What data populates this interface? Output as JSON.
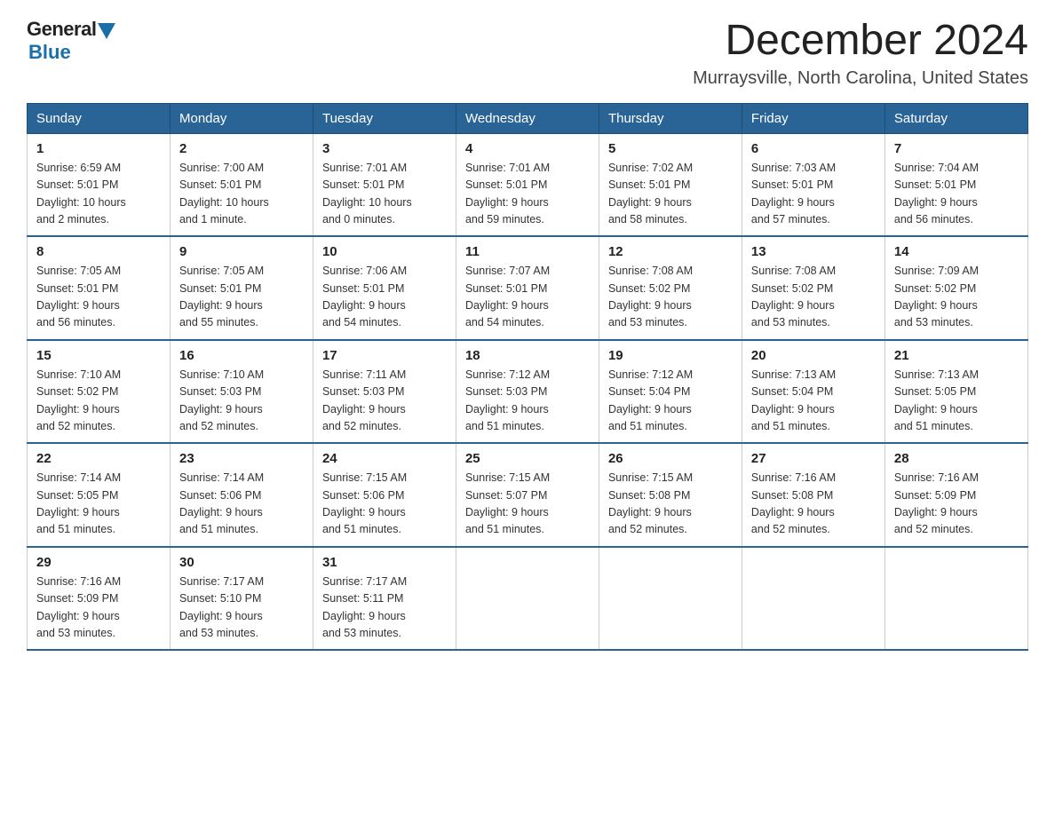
{
  "logo": {
    "general": "General",
    "blue": "Blue",
    "tagline": ""
  },
  "title": "December 2024",
  "subtitle": "Murraysville, North Carolina, United States",
  "weekdays": [
    "Sunday",
    "Monday",
    "Tuesday",
    "Wednesday",
    "Thursday",
    "Friday",
    "Saturday"
  ],
  "weeks": [
    [
      {
        "day": "1",
        "info": "Sunrise: 6:59 AM\nSunset: 5:01 PM\nDaylight: 10 hours\nand 2 minutes."
      },
      {
        "day": "2",
        "info": "Sunrise: 7:00 AM\nSunset: 5:01 PM\nDaylight: 10 hours\nand 1 minute."
      },
      {
        "day": "3",
        "info": "Sunrise: 7:01 AM\nSunset: 5:01 PM\nDaylight: 10 hours\nand 0 minutes."
      },
      {
        "day": "4",
        "info": "Sunrise: 7:01 AM\nSunset: 5:01 PM\nDaylight: 9 hours\nand 59 minutes."
      },
      {
        "day": "5",
        "info": "Sunrise: 7:02 AM\nSunset: 5:01 PM\nDaylight: 9 hours\nand 58 minutes."
      },
      {
        "day": "6",
        "info": "Sunrise: 7:03 AM\nSunset: 5:01 PM\nDaylight: 9 hours\nand 57 minutes."
      },
      {
        "day": "7",
        "info": "Sunrise: 7:04 AM\nSunset: 5:01 PM\nDaylight: 9 hours\nand 56 minutes."
      }
    ],
    [
      {
        "day": "8",
        "info": "Sunrise: 7:05 AM\nSunset: 5:01 PM\nDaylight: 9 hours\nand 56 minutes."
      },
      {
        "day": "9",
        "info": "Sunrise: 7:05 AM\nSunset: 5:01 PM\nDaylight: 9 hours\nand 55 minutes."
      },
      {
        "day": "10",
        "info": "Sunrise: 7:06 AM\nSunset: 5:01 PM\nDaylight: 9 hours\nand 54 minutes."
      },
      {
        "day": "11",
        "info": "Sunrise: 7:07 AM\nSunset: 5:01 PM\nDaylight: 9 hours\nand 54 minutes."
      },
      {
        "day": "12",
        "info": "Sunrise: 7:08 AM\nSunset: 5:02 PM\nDaylight: 9 hours\nand 53 minutes."
      },
      {
        "day": "13",
        "info": "Sunrise: 7:08 AM\nSunset: 5:02 PM\nDaylight: 9 hours\nand 53 minutes."
      },
      {
        "day": "14",
        "info": "Sunrise: 7:09 AM\nSunset: 5:02 PM\nDaylight: 9 hours\nand 53 minutes."
      }
    ],
    [
      {
        "day": "15",
        "info": "Sunrise: 7:10 AM\nSunset: 5:02 PM\nDaylight: 9 hours\nand 52 minutes."
      },
      {
        "day": "16",
        "info": "Sunrise: 7:10 AM\nSunset: 5:03 PM\nDaylight: 9 hours\nand 52 minutes."
      },
      {
        "day": "17",
        "info": "Sunrise: 7:11 AM\nSunset: 5:03 PM\nDaylight: 9 hours\nand 52 minutes."
      },
      {
        "day": "18",
        "info": "Sunrise: 7:12 AM\nSunset: 5:03 PM\nDaylight: 9 hours\nand 51 minutes."
      },
      {
        "day": "19",
        "info": "Sunrise: 7:12 AM\nSunset: 5:04 PM\nDaylight: 9 hours\nand 51 minutes."
      },
      {
        "day": "20",
        "info": "Sunrise: 7:13 AM\nSunset: 5:04 PM\nDaylight: 9 hours\nand 51 minutes."
      },
      {
        "day": "21",
        "info": "Sunrise: 7:13 AM\nSunset: 5:05 PM\nDaylight: 9 hours\nand 51 minutes."
      }
    ],
    [
      {
        "day": "22",
        "info": "Sunrise: 7:14 AM\nSunset: 5:05 PM\nDaylight: 9 hours\nand 51 minutes."
      },
      {
        "day": "23",
        "info": "Sunrise: 7:14 AM\nSunset: 5:06 PM\nDaylight: 9 hours\nand 51 minutes."
      },
      {
        "day": "24",
        "info": "Sunrise: 7:15 AM\nSunset: 5:06 PM\nDaylight: 9 hours\nand 51 minutes."
      },
      {
        "day": "25",
        "info": "Sunrise: 7:15 AM\nSunset: 5:07 PM\nDaylight: 9 hours\nand 51 minutes."
      },
      {
        "day": "26",
        "info": "Sunrise: 7:15 AM\nSunset: 5:08 PM\nDaylight: 9 hours\nand 52 minutes."
      },
      {
        "day": "27",
        "info": "Sunrise: 7:16 AM\nSunset: 5:08 PM\nDaylight: 9 hours\nand 52 minutes."
      },
      {
        "day": "28",
        "info": "Sunrise: 7:16 AM\nSunset: 5:09 PM\nDaylight: 9 hours\nand 52 minutes."
      }
    ],
    [
      {
        "day": "29",
        "info": "Sunrise: 7:16 AM\nSunset: 5:09 PM\nDaylight: 9 hours\nand 53 minutes."
      },
      {
        "day": "30",
        "info": "Sunrise: 7:17 AM\nSunset: 5:10 PM\nDaylight: 9 hours\nand 53 minutes."
      },
      {
        "day": "31",
        "info": "Sunrise: 7:17 AM\nSunset: 5:11 PM\nDaylight: 9 hours\nand 53 minutes."
      },
      {
        "day": "",
        "info": ""
      },
      {
        "day": "",
        "info": ""
      },
      {
        "day": "",
        "info": ""
      },
      {
        "day": "",
        "info": ""
      }
    ]
  ]
}
